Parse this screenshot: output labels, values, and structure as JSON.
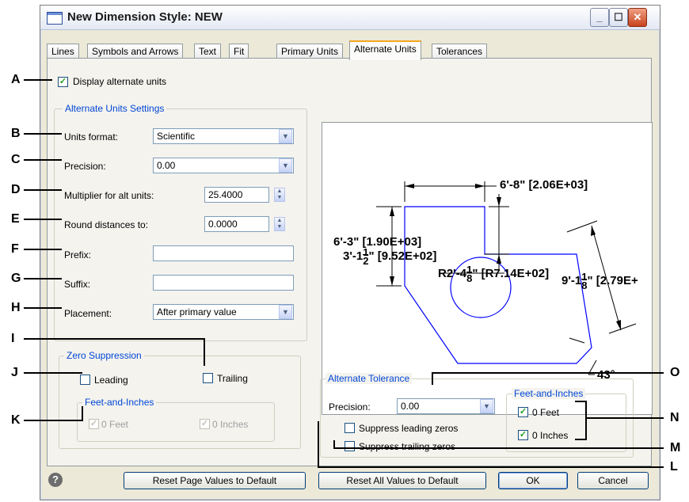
{
  "window": {
    "title": "New Dimension Style: NEW"
  },
  "tabs": [
    "Lines",
    "Symbols and Arrows",
    "Text",
    "Fit",
    "Primary Units",
    "Alternate Units",
    "Tolerances"
  ],
  "display_alternate_units": {
    "label": "Display alternate units",
    "checked": true
  },
  "settings": {
    "legend": "Alternate Units Settings",
    "units_format": {
      "label": "Units format:",
      "value": "Scientific"
    },
    "precision": {
      "label": "Precision:",
      "value": "0.00"
    },
    "multiplier": {
      "label": "Multiplier for alt units:",
      "value": "25.4000"
    },
    "round": {
      "label": "Round distances to:",
      "value": "0.0000"
    },
    "prefix": {
      "label": "Prefix:",
      "value": ""
    },
    "suffix": {
      "label": "Suffix:",
      "value": ""
    },
    "placement": {
      "label": "Placement:",
      "value": "After primary value"
    }
  },
  "zero_suppression": {
    "legend": "Zero Suppression",
    "leading": "Leading",
    "trailing": "Trailing",
    "feet_inches_legend": "Feet-and-Inches",
    "feet": "0 Feet",
    "inches": "0 Inches"
  },
  "alternate_tolerance": {
    "legend": "Alternate Tolerance",
    "precision_label": "Precision:",
    "precision_value": "0.00",
    "suppress_leading": "Suppress leading zeros",
    "suppress_trailing": "Suppress trailing zeros",
    "feet_inches_legend": "Feet-and-Inches",
    "feet": "0 Feet",
    "inches": "0 Inches"
  },
  "preview": {
    "top_dim": "6'-8\" [2.06E+03]",
    "left_dim": "6'-3\" [1.90E+03]",
    "mid_dim_a": "3'-1",
    "mid_frac_num": "1",
    "mid_frac_den": "2",
    "mid_dim_b": "\" [9.52E+02]",
    "radius_dim": "R2'-4",
    "radius_frac_num": "1",
    "radius_frac_den": "8",
    "radius_dim_b": "\" [R7.14E+02]",
    "right_dim_a": "9'-1",
    "right_frac_num": "1",
    "right_frac_den": "8",
    "right_dim_b": "\" [2.79E+",
    "angle_dim": "43°"
  },
  "buttons": {
    "reset_page": "Reset Page Values to Default",
    "reset_all": "Reset All Values to Default",
    "ok": "OK",
    "cancel": "Cancel",
    "help": "?"
  },
  "callouts": [
    "A",
    "B",
    "C",
    "D",
    "E",
    "F",
    "G",
    "H",
    "I",
    "J",
    "K",
    "L",
    "M",
    "N",
    "O"
  ]
}
